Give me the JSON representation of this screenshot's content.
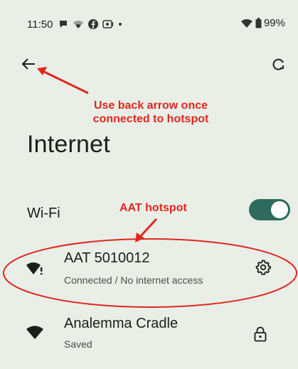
{
  "status_bar": {
    "time": "11:50",
    "battery_text": "99%",
    "icons": [
      "chat-bubble-icon",
      "wifi-low-icon",
      "facebook-icon",
      "media-icon",
      "dot-icon",
      "wifi-alert-icon",
      "battery-icon"
    ]
  },
  "header": {
    "back_icon": "back-arrow-icon",
    "refresh_icon": "refresh-icon",
    "title": "Internet"
  },
  "annotations": {
    "back_note_line1": "Use back arrow once",
    "back_note_line2": "connected to hotspot",
    "hotspot_note": "AAT hotspot",
    "color": "#e0261f"
  },
  "wifi": {
    "label": "Wi-Fi",
    "enabled": true,
    "toggle_color": "#2e6b5c"
  },
  "networks": [
    {
      "name": "AAT 5010012",
      "status": "Connected / No internet access",
      "icon": "wifi-alert-icon",
      "action_icon": "gear-icon"
    },
    {
      "name": "Analemma Cradle",
      "status": "Saved",
      "icon": "wifi-icon",
      "action_icon": "lock-icon"
    }
  ]
}
